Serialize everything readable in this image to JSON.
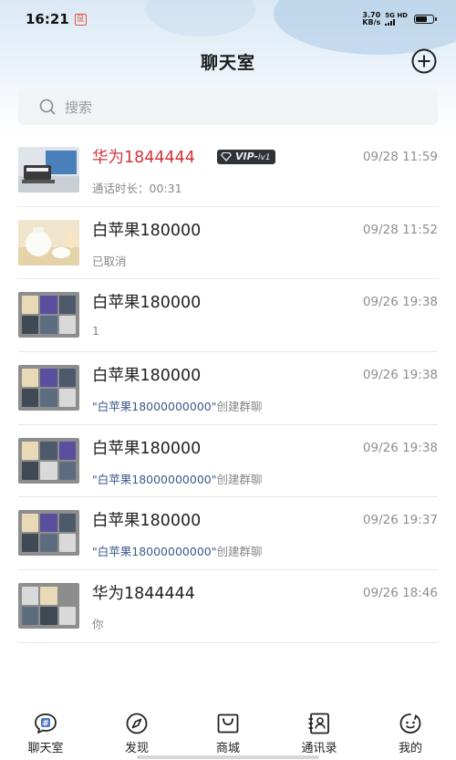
{
  "status_bar": {
    "time": "16:21",
    "notification": "鼠",
    "net_speed_value": "3.70",
    "net_speed_unit": "KB/s",
    "network": "5G HD"
  },
  "header": {
    "title": "聊天室",
    "add_icon": "plus-circle-icon"
  },
  "search": {
    "placeholder": "搜索",
    "icon": "search-icon"
  },
  "chats": [
    {
      "name": "华为1844444",
      "name_color": "#d2323a",
      "vip_label": "VIP-",
      "vip_level": "lv1",
      "time": "09/28 11:59",
      "preview": "通话时长：00:31",
      "avatar": "product-photo"
    },
    {
      "name": "白苹果180000",
      "time": "09/28 11:52",
      "preview": "已取消",
      "avatar": "product-photo"
    },
    {
      "name": "白苹果180000",
      "time": "09/26 19:38",
      "preview": "1",
      "avatar": "group-grid"
    },
    {
      "name": "白苹果180000",
      "time": "09/26 19:38",
      "preview_quoted": "\"白苹果18000000000\"",
      "preview_suffix": "创建群聊",
      "avatar": "group-grid"
    },
    {
      "name": "白苹果180000",
      "time": "09/26 19:38",
      "preview_quoted": "\"白苹果18000000000\"",
      "preview_suffix": "创建群聊",
      "avatar": "group-grid"
    },
    {
      "name": "白苹果180000",
      "time": "09/26 19:37",
      "preview_quoted": "\"白苹果18000000000\"",
      "preview_suffix": "创建群聊",
      "avatar": "group-grid"
    },
    {
      "name": "华为1844444",
      "time": "09/26 18:46",
      "preview": "你",
      "avatar": "group-grid"
    }
  ],
  "tabs": [
    {
      "label": "聊天室",
      "icon": "chat-hash-icon",
      "active": true
    },
    {
      "label": "发现",
      "icon": "compass-icon"
    },
    {
      "label": "商城",
      "icon": "shop-bag-icon"
    },
    {
      "label": "通讯录",
      "icon": "contacts-book-icon"
    },
    {
      "label": "我的",
      "icon": "smiley-face-icon"
    }
  ],
  "colors": {
    "accent_red": "#d2323a",
    "quoted_blue": "#3d5a8c",
    "active_tab_badge": "#4a78c8"
  }
}
